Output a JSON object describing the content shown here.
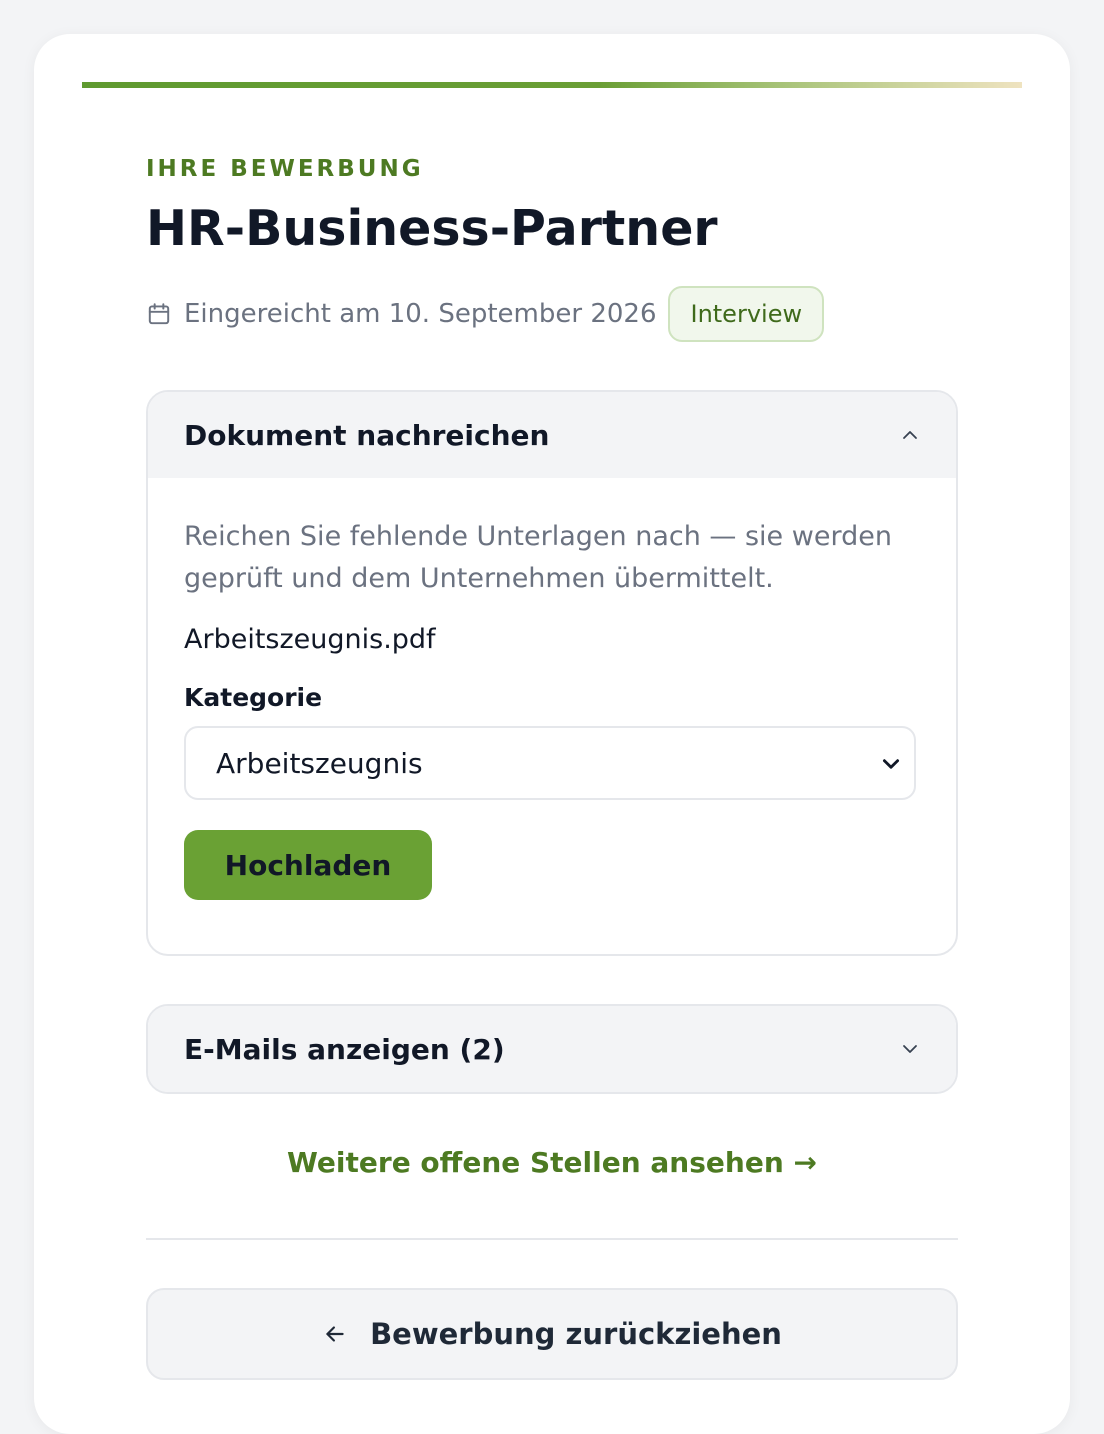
{
  "header": {
    "eyebrow": "IHRE BEWERBUNG",
    "title": "HR-Business-Partner",
    "submitted": "Eingereicht am 10. September 2026",
    "status_badge": "Interview",
    "icon": "calendar-icon"
  },
  "upload_panel": {
    "title": "Dokument nachreichen",
    "expanded": true,
    "description": "Reichen Sie fehlende Unterlagen nach — sie werden geprüft und dem Unternehmen übermittelt.",
    "file_name": "Arbeitszeugnis.pdf",
    "category_label": "Kategorie",
    "category_value": "Arbeitszeugnis",
    "upload_button": "Hochladen"
  },
  "mail_panel": {
    "title": "E-Mails anzeigen (2)",
    "expanded": false
  },
  "links": {
    "more_jobs": "Weitere offene Stellen ansehen →"
  },
  "actions": {
    "withdraw": "Bewerbung zurückziehen"
  },
  "colors": {
    "accent": "#5f9a30",
    "accent_text": "#4d7a22",
    "button": "#6aa134",
    "badge_bg": "#f1f7ec"
  }
}
